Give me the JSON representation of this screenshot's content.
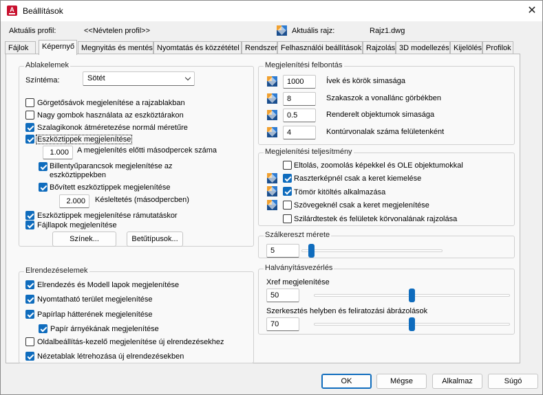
{
  "window": {
    "title": "Beállítások",
    "close_symbol": "✕"
  },
  "header": {
    "current_profile_label": "Aktuális profil:",
    "current_profile_value": "<<Névtelen profil>>",
    "current_drawing_label": "Aktuális rajz:",
    "current_drawing_value": "Rajz1.dwg"
  },
  "tabs": [
    "Fájlok",
    "Képernyő",
    "Megnyitás és mentés",
    "Nyomtatás és közzététel",
    "Rendszer",
    "Felhasználói beállítások",
    "Rajzolás",
    "3D modellezés",
    "Kijelölés",
    "Profilok"
  ],
  "active_tab": "Képernyő",
  "window_elements": {
    "title": "Ablakelemek",
    "color_scheme_label": "Színtéma:",
    "color_scheme_value": "Sötét",
    "checkboxes": [
      {
        "label": "Görgetősávok megjelenítése a rajzablakban",
        "checked": false
      },
      {
        "label": "Nagy gombok használata az eszköztárakon",
        "checked": false
      },
      {
        "label": "Szalagikonok átméretezése normál méretűre",
        "checked": true
      },
      {
        "label": "Eszköztippek megjelenítése",
        "checked": true
      },
      {
        "label": "Billentyűparancsok megjelenítése az eszköztippekben",
        "checked": true
      },
      {
        "label": "Bővített eszköztippek megjelenítése",
        "checked": true
      },
      {
        "label": "Eszköztippek megjelenítése rámutatáskor",
        "checked": true
      },
      {
        "label": "Fájllapok megjelenítése",
        "checked": true
      }
    ],
    "tooltip_delay_value": "1.000",
    "tooltip_delay_label": "A megjelenítés előtti másodpercek száma",
    "extended_delay_value": "2.000",
    "extended_delay_label": "Késleltetés (másodpercben)",
    "colors_button": "Színek...",
    "fonts_button": "Betűtípusok..."
  },
  "layout_elements": {
    "title": "Elrendezéselemek",
    "checkboxes": [
      {
        "label": "Elrendezés és Modell lapok megjelenítése",
        "checked": true
      },
      {
        "label": "Nyomtatható terület megjelenítése",
        "checked": true
      },
      {
        "label": "Papírlap hátterének megjelenítése",
        "checked": true
      },
      {
        "label": "Papír árnyékának megjelenítése",
        "checked": true
      },
      {
        "label": "Oldalbeállítás-kezelő megjelenítése új elrendezésekhez",
        "checked": false
      },
      {
        "label": "Nézetablak létrehozása új elrendezésekben",
        "checked": true
      }
    ]
  },
  "display_resolution": {
    "title": "Megjelenítési felbontás",
    "rows": [
      {
        "value": "1000",
        "label": "Ívek és körök simasága"
      },
      {
        "value": "8",
        "label": "Szakaszok a vonallánc görbékben"
      },
      {
        "value": "0.5",
        "label": "Renderelt objektumok simasága"
      },
      {
        "value": "4",
        "label": "Kontúrvonalak száma felületenként"
      }
    ]
  },
  "display_performance": {
    "title": "Megjelenítési teljesítmény",
    "checkboxes": [
      {
        "label": "Eltolás, zoomolás képekkel és OLE objektumokkal",
        "checked": false
      },
      {
        "label": "Raszterképnél csak a keret kiemelése",
        "checked": true
      },
      {
        "label": "Tömör kitöltés alkalmazása",
        "checked": true
      },
      {
        "label": "Szövegeknél csak a keret megjelenítése",
        "checked": false
      },
      {
        "label": "Szilárdtestek és felületek körvonalának rajzolása",
        "checked": false
      }
    ]
  },
  "crosshair": {
    "title": "Szálkereszt mérete",
    "value": "5",
    "level_fraction": 0.05
  },
  "fade_control": {
    "title": "Halványításvezérlés",
    "xref_label": "Xref megjelenítése",
    "xref_value": "50",
    "xref_level_fraction": 0.5,
    "inplace_label": "Szerkesztés helyben és feliratozási ábrázolások",
    "inplace_value": "70",
    "inplace_level_fraction": 0.5
  },
  "footer": {
    "ok": "OK",
    "cancel": "Mégse",
    "apply": "Alkalmaz",
    "help": "Súgó"
  },
  "colors": {
    "accent": "#0f6cbd",
    "app_red": "#c8102e"
  }
}
